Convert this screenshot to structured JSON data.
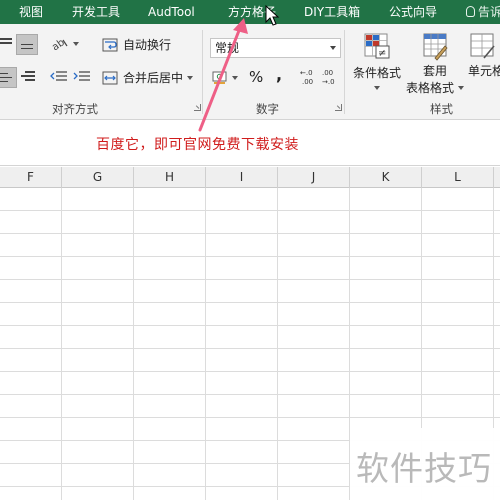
{
  "menu": {
    "tabs": [
      {
        "label": "视图"
      },
      {
        "label": "开发工具"
      },
      {
        "label": "AudTool"
      },
      {
        "label": "方方格子"
      },
      {
        "label": "DIY工具箱"
      },
      {
        "label": "公式向导"
      }
    ],
    "tell_me": "告诉"
  },
  "ribbon": {
    "alignment": {
      "group_label": "对齐方式",
      "wrap_text": "自动换行",
      "merge_center": "合并后居中"
    },
    "number": {
      "group_label": "数字",
      "format_value": "常规",
      "percent": "%",
      "comma": ",",
      "increase_decimal": ".0 → .00",
      "decrease_decimal": ".00 → .0"
    },
    "styles": {
      "group_label": "样式",
      "conditional_format": "条件格式",
      "table_format_line1": "套用",
      "table_format_line2": "表格格式",
      "cell_styles": "单元格"
    }
  },
  "annotation": {
    "text": "百度它，即可官网免费下载安装",
    "color": "#d01c1c",
    "arrow_color": "#ee5f86"
  },
  "sheet": {
    "columns": [
      "F",
      "G",
      "H",
      "I",
      "J",
      "K",
      "L"
    ]
  },
  "watermark": "软件技巧",
  "colors": {
    "ribbon_tab_bar": "#217346",
    "ribbon_body": "#f3f3f3"
  }
}
